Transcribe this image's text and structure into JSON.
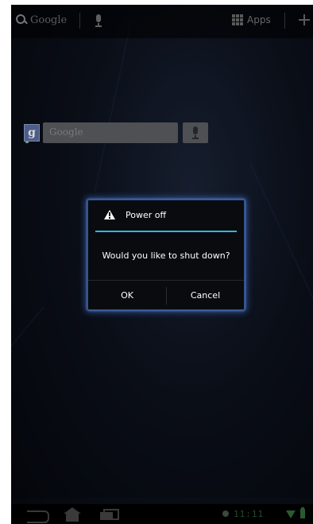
{
  "top_bar": {
    "search_label": "Google",
    "apps_label": "Apps"
  },
  "search_widget": {
    "logo_letter": "g",
    "field_label": "Google"
  },
  "dialog": {
    "title": "Power off",
    "message": "Would you like to shut down?",
    "ok_label": "OK",
    "cancel_label": "Cancel",
    "accent_color": "#33b5e5"
  },
  "system_bar": {
    "clock_text": "11:11"
  },
  "colors": {
    "wallpaper": "#0c111c",
    "dialog_glow": "#4678dc",
    "status_green": "#2a5a30"
  },
  "icons": [
    "search-icon",
    "mic-icon",
    "apps-grid-icon",
    "add-icon",
    "warning-icon",
    "back-icon",
    "home-icon",
    "recent-apps-icon",
    "wifi-icon",
    "battery-icon"
  ]
}
